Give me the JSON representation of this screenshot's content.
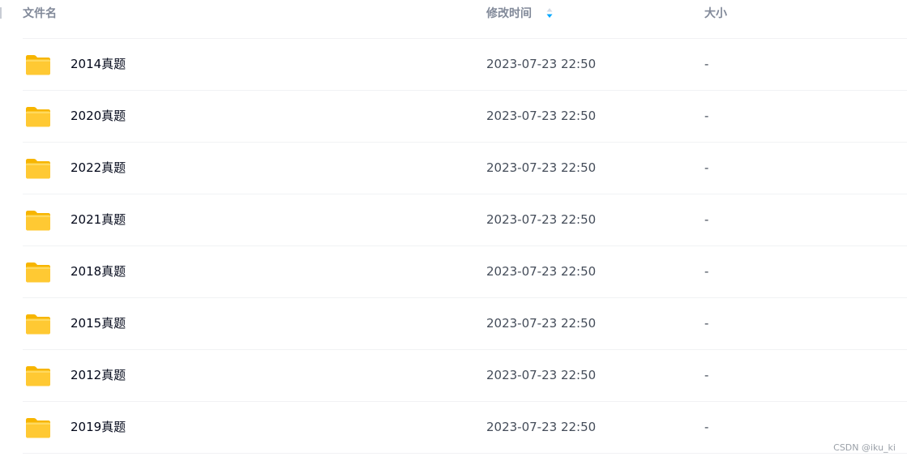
{
  "columns": {
    "name": "文件名",
    "modified": "修改时间",
    "size": "大小"
  },
  "sort": {
    "column": "modified",
    "icon": "sort-arrows-icon",
    "active_color": "#06a7ff"
  },
  "colors": {
    "folder": "#ffc41f",
    "header_text": "#818999",
    "name_text": "#03081a",
    "meta_text": "#454d5a",
    "divider": "#f1f2f4"
  },
  "files": [
    {
      "name": "2014真题",
      "modified": "2023-07-23 22:50",
      "size": "-",
      "icon": "folder-icon"
    },
    {
      "name": "2020真题",
      "modified": "2023-07-23 22:50",
      "size": "-",
      "icon": "folder-icon"
    },
    {
      "name": "2022真题",
      "modified": "2023-07-23 22:50",
      "size": "-",
      "icon": "folder-icon"
    },
    {
      "name": "2021真题",
      "modified": "2023-07-23 22:50",
      "size": "-",
      "icon": "folder-icon"
    },
    {
      "name": "2018真题",
      "modified": "2023-07-23 22:50",
      "size": "-",
      "icon": "folder-icon"
    },
    {
      "name": "2015真题",
      "modified": "2023-07-23 22:50",
      "size": "-",
      "icon": "folder-icon"
    },
    {
      "name": "2012真题",
      "modified": "2023-07-23 22:50",
      "size": "-",
      "icon": "folder-icon"
    },
    {
      "name": "2019真题",
      "modified": "2023-07-23 22:50",
      "size": "-",
      "icon": "folder-icon"
    }
  ],
  "watermark": "CSDN @iku_ki"
}
